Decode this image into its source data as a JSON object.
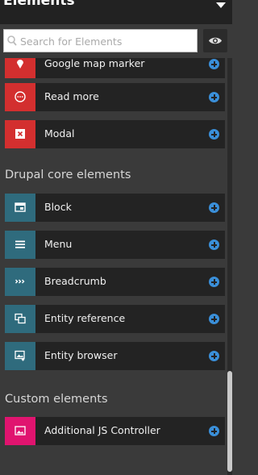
{
  "header": {
    "title": "Elements"
  },
  "search": {
    "placeholder": "Search for Elements",
    "value": ""
  },
  "groups": [
    {
      "title": "",
      "items": [
        {
          "label": "Google map marker",
          "icon": "map-marker-icon",
          "color": "#d32f2f"
        },
        {
          "label": "Read more",
          "icon": "ellipsis-circle-icon",
          "color": "#d32f2f"
        },
        {
          "label": "Modal",
          "icon": "modal-close-icon",
          "color": "#d32f2f"
        }
      ]
    },
    {
      "title": "Drupal core elements",
      "items": [
        {
          "label": "Block",
          "icon": "block-icon",
          "color": "#2f6b7d"
        },
        {
          "label": "Menu",
          "icon": "menu-icon",
          "color": "#2f6b7d"
        },
        {
          "label": "Breadcrumb",
          "icon": "breadcrumb-icon",
          "color": "#2f6b7d"
        },
        {
          "label": "Entity reference",
          "icon": "entity-reference-icon",
          "color": "#2f6b7d"
        },
        {
          "label": "Entity browser",
          "icon": "entity-browser-icon",
          "color": "#2f6b7d"
        }
      ]
    },
    {
      "title": "Custom elements",
      "items": [
        {
          "label": "Additional JS Controller",
          "icon": "image-icon",
          "color": "#e0146f"
        }
      ]
    }
  ]
}
